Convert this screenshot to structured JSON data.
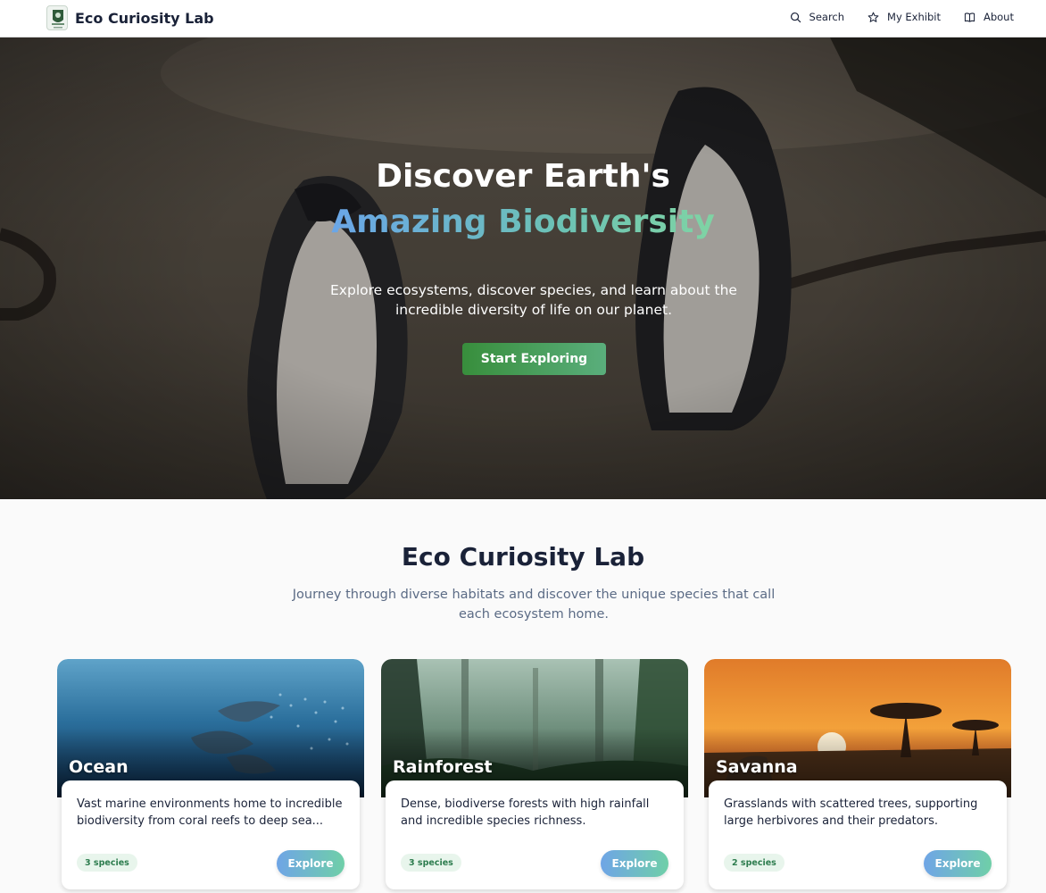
{
  "brand": {
    "name": "Eco Curiosity Lab",
    "logo_icon": "eco-lab-logo-icon"
  },
  "nav": {
    "items": [
      {
        "label": "Search",
        "icon": "search-icon"
      },
      {
        "label": "My Exhibit",
        "icon": "star-icon"
      },
      {
        "label": "About",
        "icon": "book-icon"
      }
    ]
  },
  "hero": {
    "title_line1": "Discover Earth's",
    "title_line2": "Amazing Biodiversity",
    "subtitle": "Explore ecosystems, discover species, and learn about the incredible diversity of life on our planet.",
    "cta_label": "Start Exploring",
    "background": "penguins-photo"
  },
  "section": {
    "title": "Eco Curiosity Lab",
    "subtitle": "Journey through diverse habitats and discover the unique species that call each ecosystem home."
  },
  "ecosystems": [
    {
      "name": "Ocean",
      "description": "Vast marine environments home to incredible biodiversity from coral reefs to deep sea...",
      "species": "3 species",
      "button": "Explore",
      "image": "dolphins-underwater-photo"
    },
    {
      "name": "Rainforest",
      "description": "Dense, biodiverse forests with high rainfall and incredible species richness.",
      "species": "3 species",
      "button": "Explore",
      "image": "misty-jungle-photo"
    },
    {
      "name": "Savanna",
      "description": "Grasslands with scattered trees, supporting large herbivores and their predators.",
      "species": "2 species",
      "button": "Explore",
      "image": "savanna-sunset-photo"
    }
  ],
  "colors": {
    "accent_green": "#388e3c",
    "gradient_blue": "#6fa5e6",
    "gradient_teal": "#6fcfa8",
    "text_dark": "#1a2238"
  }
}
